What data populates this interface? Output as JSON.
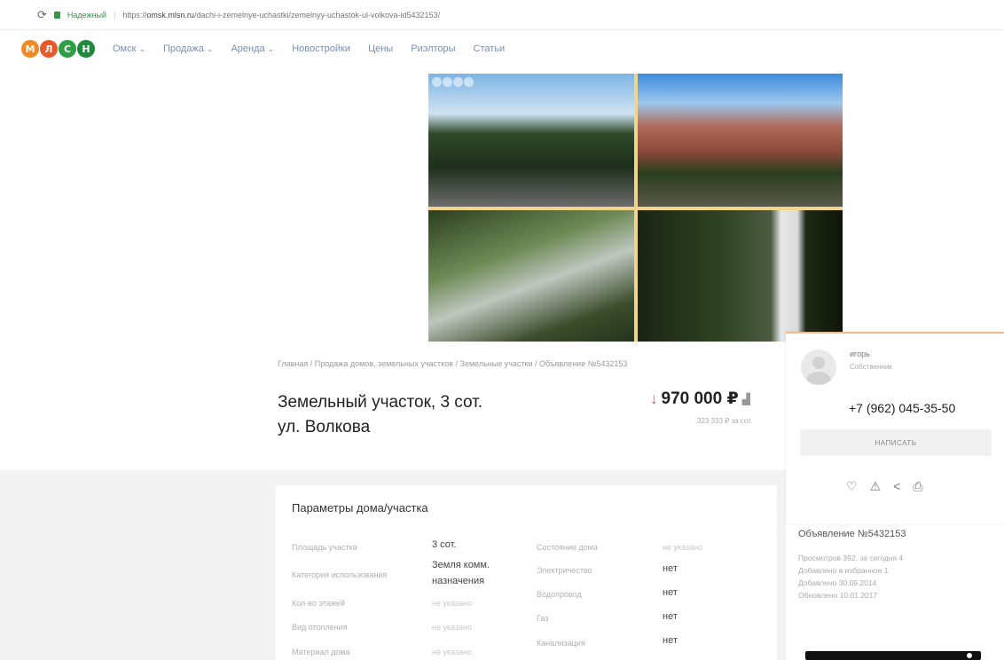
{
  "browser": {
    "secure_label": "Надежный",
    "url_prefix": "https://",
    "url_host": "omsk.mlsn.ru",
    "url_path": "/dachi-i-zemelnye-uchastki/zemelnyy-uchastok-ul-volkova-id5432153/"
  },
  "logo": {
    "letters": [
      "М",
      "Л",
      "С",
      "Н"
    ],
    "colors": [
      "#f08a24",
      "#e9592c",
      "#2e9f45",
      "#1f8a3a"
    ]
  },
  "nav": {
    "items": [
      {
        "label": "Омск",
        "dropdown": true
      },
      {
        "label": "Продажа",
        "dropdown": true
      },
      {
        "label": "Аренда",
        "dropdown": true
      },
      {
        "label": "Новостройки",
        "dropdown": false
      },
      {
        "label": "Цены",
        "dropdown": false
      },
      {
        "label": "Риэлторы",
        "dropdown": false
      },
      {
        "label": "Статьи",
        "dropdown": false
      }
    ]
  },
  "breadcrumb": "Главная / Продажа домов, земельных участков / Земельные участки / Объявление №5432153",
  "listing": {
    "title_line1": "Земельный участок, 3 сот.",
    "title_line2": "ул. Волкова",
    "price": "970 000 ₽",
    "price_trend": "down",
    "price_per_unit": "323 333 ₽ за сот."
  },
  "params": {
    "heading": "Параметры дома/участка",
    "left": [
      {
        "label": "Площадь участка",
        "value": "3 сот.",
        "na": false
      },
      {
        "label": "Категория использования",
        "value": "Земля комм. назначения",
        "na": false
      },
      {
        "label": "Кол-во этажей",
        "value": "не указано",
        "na": true
      },
      {
        "label": "Вид отопления",
        "value": "не указано",
        "na": true
      },
      {
        "label": "Материал дома",
        "value": "не указано",
        "na": true
      }
    ],
    "right": [
      {
        "label": "Состояние дома",
        "value": "не указано",
        "na": true
      },
      {
        "label": "Электричество",
        "value": "нет",
        "na": false
      },
      {
        "label": "Водопровод",
        "value": "нет",
        "na": false
      },
      {
        "label": "Газ",
        "value": "нет",
        "na": false
      },
      {
        "label": "Канализация",
        "value": "нет",
        "na": false
      }
    ]
  },
  "seller": {
    "name": "игорь",
    "role": "Собственник",
    "phone": "+7 (962) 045-35-50",
    "write_label": "НАПИСАТЬ"
  },
  "ad": {
    "title": "Объявление №5432153",
    "views": "Просмотров 392, за сегодня 4",
    "favorites": "Добавлено в избранное 1",
    "added": "Добавлено 30.09.2014",
    "updated": "Обновлено 10.01.2017"
  },
  "icons": [
    "reload-icon",
    "lock-icon",
    "heart-icon",
    "warning-icon",
    "share-icon",
    "print-icon",
    "price-chart-icon",
    "price-down-icon"
  ]
}
